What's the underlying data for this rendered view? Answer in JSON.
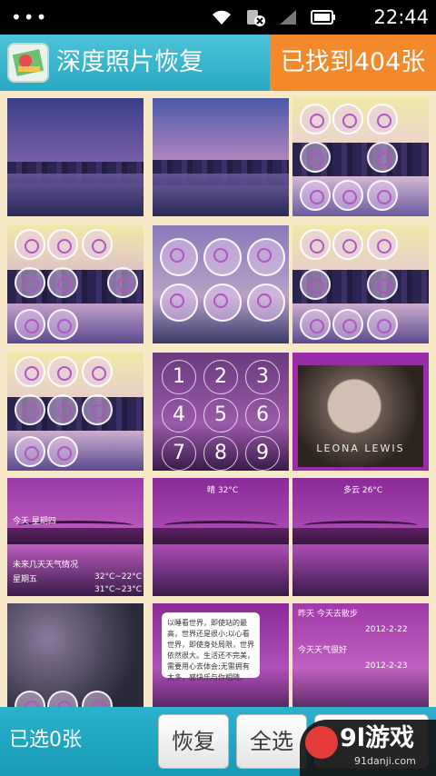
{
  "status_bar": {
    "time": "22:44",
    "icons": [
      "menu-dots-icon",
      "wifi-icon",
      "sim-blocked-icon",
      "signal-icon",
      "battery-icon"
    ]
  },
  "header": {
    "title": "深度照片恢复",
    "found_label": "已找到404张",
    "colors": {
      "bar": "#2aa8c4",
      "found_badge": "#f28a2b"
    }
  },
  "grid": {
    "thumbnails": [
      {
        "content": "city-night-bridge-photo"
      },
      {
        "content": "city-skyline-dusk-photo"
      },
      {
        "content": "theme-icons-screenshot"
      },
      {
        "content": "theme-icons-screenshot"
      },
      {
        "content": "theme-icons-closeup-screenshot"
      },
      {
        "content": "theme-icons-screenshot"
      },
      {
        "content": "theme-icons-screenshot"
      },
      {
        "content": "lockscreen-keypad-screenshot",
        "keys": [
          "1",
          "2",
          "3",
          "4",
          "5",
          "6",
          "7",
          "8",
          "9"
        ]
      },
      {
        "content": "album-cover-photo",
        "text": "LEONA LEWIS"
      },
      {
        "content": "weather-widget-screenshot",
        "lines": [
          "今天 星期四",
          "未来几天天气情况",
          "星期五",
          "32°C~22°C",
          "31°C~23°C"
        ]
      },
      {
        "content": "bridge-purple-wallpaper",
        "text": "晴 32°C"
      },
      {
        "content": "bridge-purple-wallpaper",
        "text": "多云 26°C"
      },
      {
        "content": "bokeh-icons-screenshot"
      },
      {
        "content": "note-card-screenshot",
        "note": "以睡看世界，即使站的最高，世界还是很小;以心看世界，即使身处局限，世界依然很大。生活还不完美，需要用心去体会;无需拥有太多，感快乐与你相随。"
      },
      {
        "content": "sms-list-screenshot",
        "lines": [
          "昨天 今天去散步",
          "2012-2-22",
          "今天天气很好",
          "2012-2-23"
        ]
      }
    ]
  },
  "bottom_bar": {
    "selected_count": "已选0张",
    "restore_label": "恢复",
    "select_all_label": "全选"
  },
  "watermark": {
    "brand": "游戏",
    "prefix": "9l",
    "url": "91danji.com"
  }
}
